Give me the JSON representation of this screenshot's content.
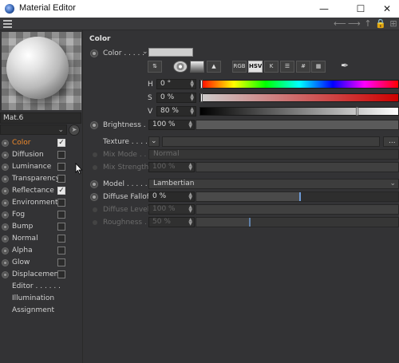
{
  "window": {
    "title": "Material Editor",
    "minimize": "—",
    "maximize": "☐",
    "close": "✕"
  },
  "material": {
    "name": "Mat.6"
  },
  "channels": [
    {
      "label": "Color",
      "dots": " . . . . .",
      "checked": true,
      "active": true
    },
    {
      "label": "Diffusion",
      "dots": " . . .",
      "checked": false,
      "active": false
    },
    {
      "label": "Luminance",
      "dots": " . .",
      "checked": false,
      "active": false
    },
    {
      "label": "Transparency",
      "dots": "",
      "checked": false,
      "active": false
    },
    {
      "label": "Reflectance",
      "dots": "",
      "checked": true,
      "active": false
    },
    {
      "label": "Environment",
      "dots": "",
      "checked": false,
      "active": false
    },
    {
      "label": "Fog",
      "dots": " . . . . . .",
      "checked": false,
      "active": false
    },
    {
      "label": "Bump",
      "dots": " . . . . .",
      "checked": false,
      "active": false
    },
    {
      "label": "Normal",
      "dots": " . . . .",
      "checked": false,
      "active": false
    },
    {
      "label": "Alpha",
      "dots": " . . . . .",
      "checked": false,
      "active": false
    },
    {
      "label": "Glow",
      "dots": " . . . . . .",
      "checked": false,
      "active": false
    },
    {
      "label": "Displacement",
      "dots": "",
      "checked": false,
      "active": false
    }
  ],
  "extras": [
    "Editor . . . . . .",
    "Illumination",
    "Assignment"
  ],
  "color_section": {
    "title": "Color",
    "color_label": "Color . . . . .",
    "swatch_color": "#cfcfcf",
    "mode_buttons": [
      "RGB",
      "HSV",
      "K",
      "☰",
      "#",
      "▦"
    ],
    "selected_mode": "HSV",
    "h_label": "H",
    "h_value": "0 °",
    "s_label": "S",
    "s_value": "0 %",
    "v_label": "V",
    "v_value": "80 %",
    "v_level": 0.8,
    "brightness_label": "Brightness . .",
    "brightness_value": "100 %",
    "texture_label": "Texture . . . . .",
    "texture_more": "...",
    "mix_mode_label": "Mix Mode . . .",
    "mix_mode_value": "Normal",
    "mix_strength_label": "Mix Strength",
    "mix_strength_value": "100 %",
    "model_label": "Model . . . . . .",
    "model_value": "Lambertian",
    "diffuse_falloff_label": "Diffuse Falloff",
    "diffuse_falloff_value": "0 %",
    "diffuse_level_label": "Diffuse Level",
    "diffuse_level_value": "100 %",
    "roughness_label": "Roughness . .",
    "roughness_value": "50 %"
  }
}
